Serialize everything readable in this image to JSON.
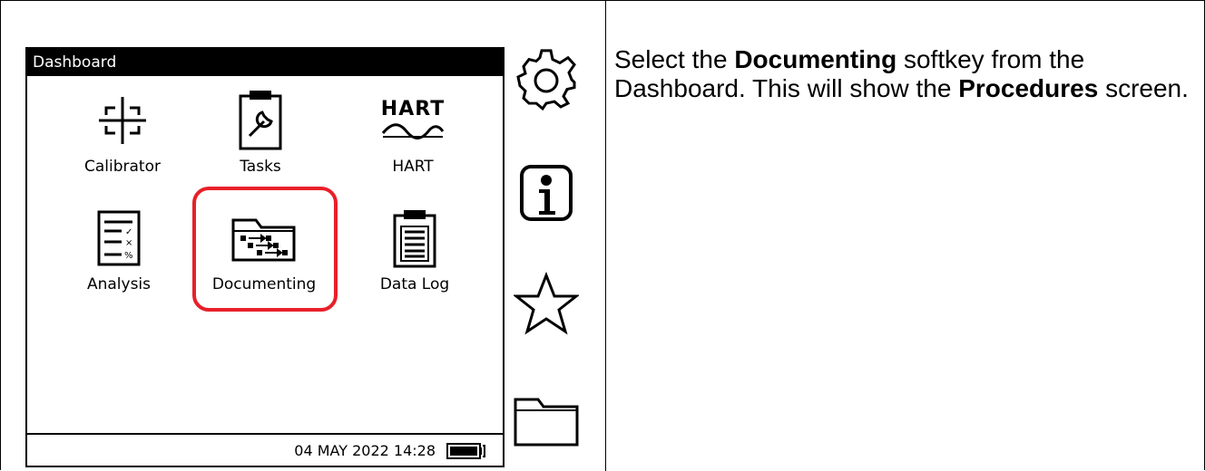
{
  "screen": {
    "title": "Dashboard",
    "tiles": [
      {
        "label": "Calibrator",
        "icon": "calibrator-icon"
      },
      {
        "label": "Tasks",
        "icon": "tasks-icon"
      },
      {
        "label": "HART",
        "icon": "hart-icon",
        "icon_text": "HART"
      },
      {
        "label": "Analysis",
        "icon": "analysis-icon"
      },
      {
        "label": "Documenting",
        "icon": "documenting-icon",
        "highlighted": true
      },
      {
        "label": "Data Log",
        "icon": "data-log-icon"
      }
    ],
    "status": {
      "datetime": "04 MAY 2022 14:28",
      "battery_icon": "battery-full-icon"
    }
  },
  "softkeys": [
    {
      "icon": "settings-gear-icon"
    },
    {
      "icon": "info-icon"
    },
    {
      "icon": "favorites-star-icon"
    },
    {
      "icon": "folder-icon"
    }
  ],
  "instruction": {
    "part1": "Select the ",
    "bold1": "Documenting",
    "part2": " softkey from the Dashboard. This will show the ",
    "bold2": "Procedures",
    "part3": " screen."
  },
  "colors": {
    "highlight": "#e8202a"
  }
}
